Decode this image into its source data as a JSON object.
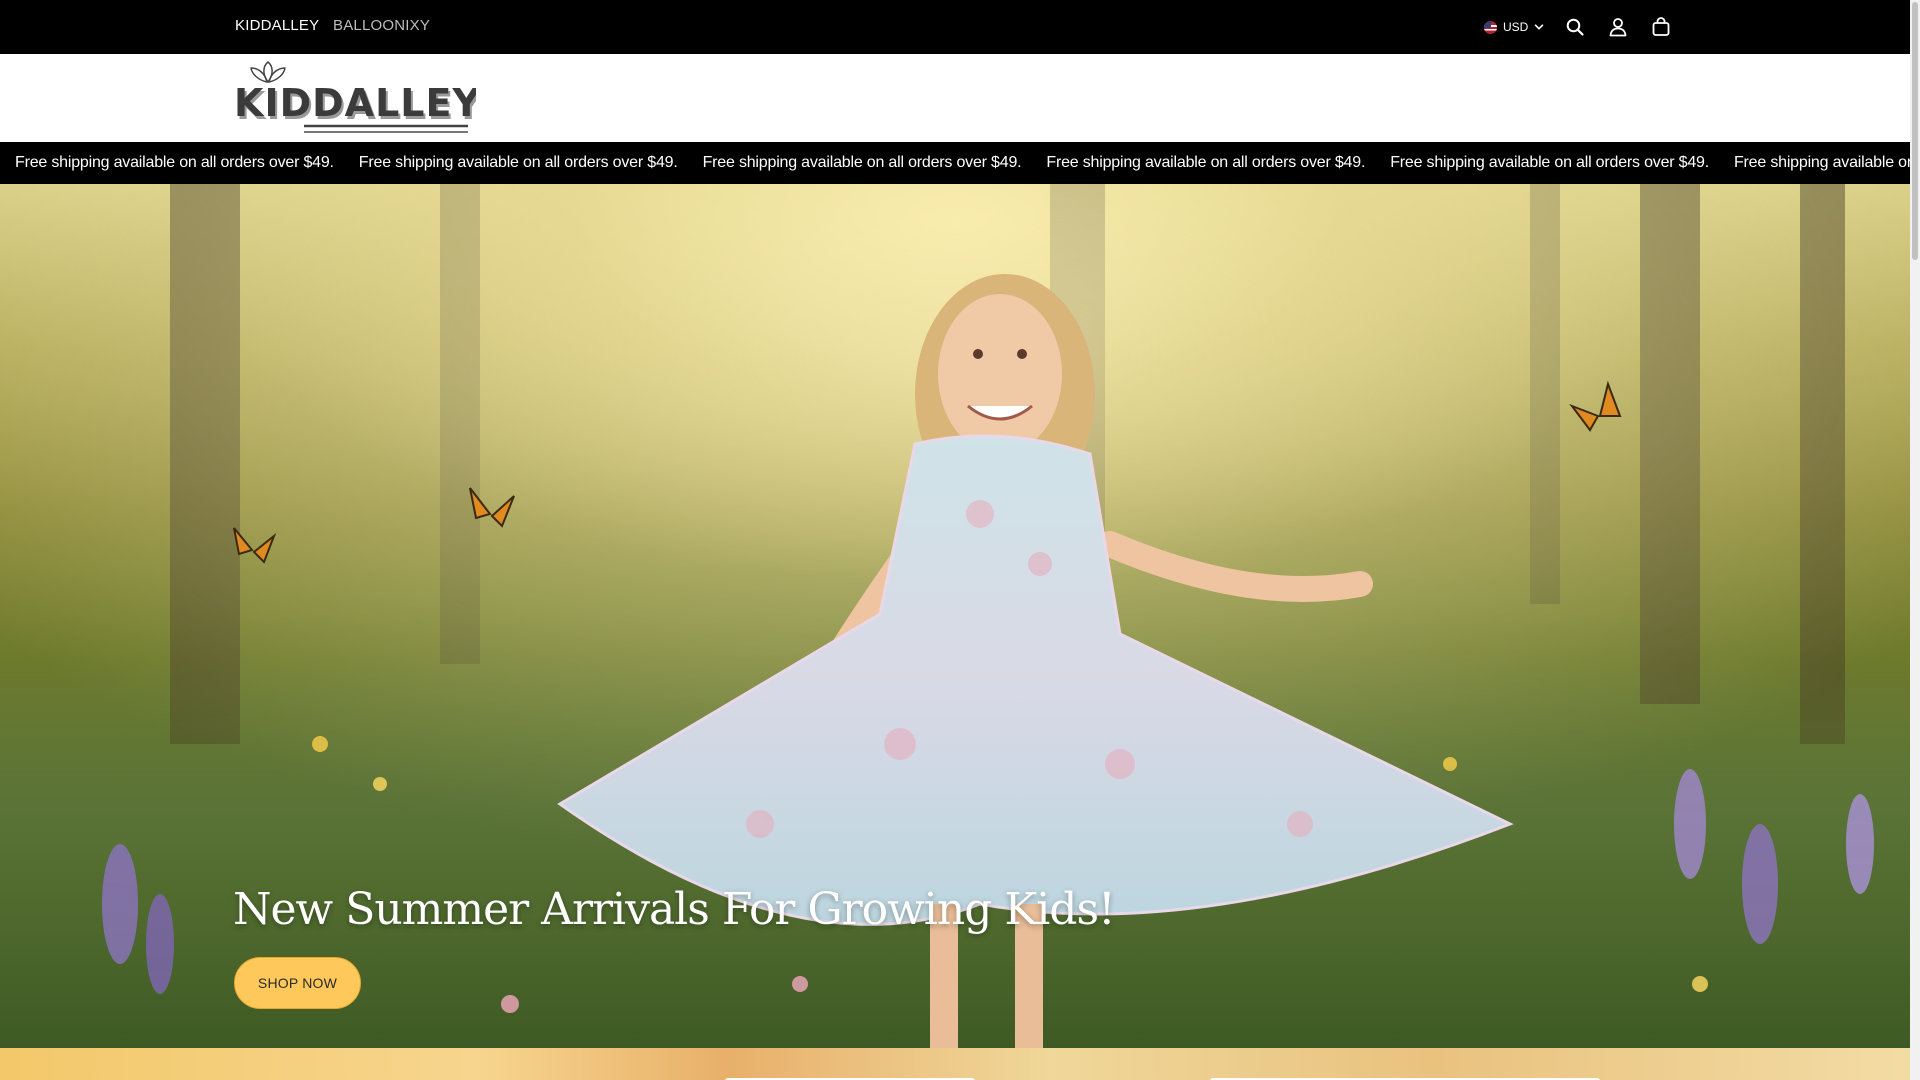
{
  "topbar": {
    "store_links": [
      "KIDDALLEY",
      "BALLOONIXY"
    ],
    "currency": "USD",
    "icons": [
      "search-icon",
      "account-icon",
      "cart-icon"
    ]
  },
  "logo": {
    "text": "KIDDALLEY"
  },
  "announcement": {
    "text": "Free shipping available on all orders over $49.",
    "repeat": 6
  },
  "hero": {
    "title": "New Summer Arrivals For Growing Kids!",
    "button_label": "SHOP NOW",
    "button_color": "#ffc85a"
  },
  "colors": {
    "topbar_bg": "#000000",
    "marquee_bg": "#000000",
    "page_bg": "#ffffff"
  }
}
